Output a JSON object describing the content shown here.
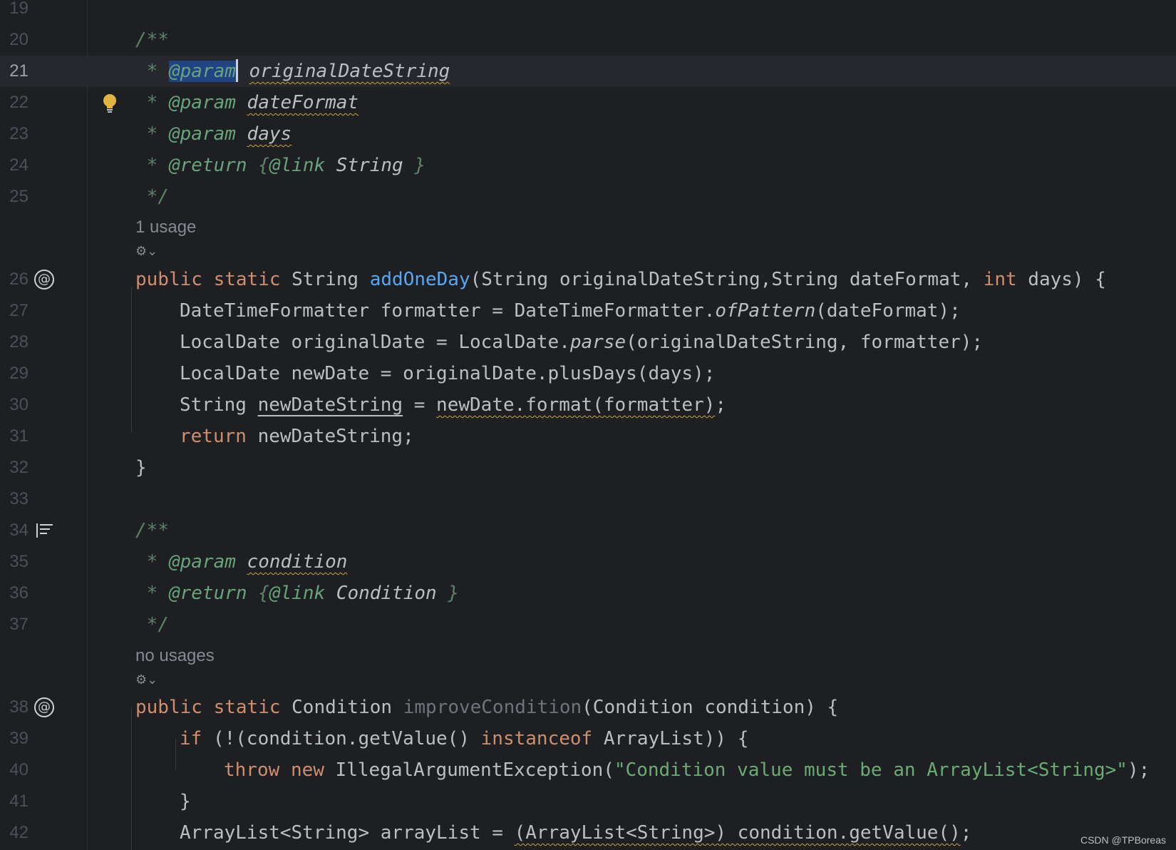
{
  "gutter": {
    "line_numbers": [
      "19",
      "20",
      "21",
      "22",
      "23",
      "24",
      "25",
      "26",
      "27",
      "28",
      "29",
      "30",
      "31",
      "32",
      "33",
      "34",
      "35",
      "36",
      "37",
      "38",
      "39",
      "40",
      "41",
      "42"
    ]
  },
  "code": {
    "l20": "/**",
    "l21": {
      "star": " * ",
      "tag": "@param",
      "name": "originalDateString"
    },
    "l22": {
      "star": " * ",
      "tag": "@param",
      "name": "dateFormat"
    },
    "l23": {
      "star": " * ",
      "tag": "@param",
      "name": "days"
    },
    "l24": {
      "star": " * ",
      "tag": "@return",
      "open": " {",
      "link": "@link",
      "type": " String",
      "close": " }"
    },
    "l25": " */",
    "l26": {
      "kw1": "public",
      "kw2": "static",
      "type": "String",
      "fn": "addOneDay",
      "p1": "(String originalDateString,String dateFormat, ",
      "kw3": "int",
      "p2": " days) {"
    },
    "l27": {
      "a": "DateTimeFormatter formatter = DateTimeFormatter.",
      "i": "ofPattern",
      "b": "(dateFormat);"
    },
    "l28": {
      "a": "LocalDate originalDate = LocalDate.",
      "i": "parse",
      "b": "(originalDateString, formatter);"
    },
    "l29": "LocalDate newDate = originalDate.plusDays(days);",
    "l30": {
      "a": "String ",
      "v": "newDateString",
      "b": " = ",
      "w": "newDate.format(formatter)",
      "c": ";"
    },
    "l31": {
      "kw": "return",
      "rest": " newDateString;"
    },
    "l32": "}",
    "l34": "/**",
    "l35": {
      "star": " * ",
      "tag": "@param",
      "name": "condition"
    },
    "l36": {
      "star": " * ",
      "tag": "@return",
      "open": " {",
      "link": "@link",
      "type": " Condition",
      "close": " }"
    },
    "l37": " */",
    "l38": {
      "kw1": "public",
      "kw2": "static",
      "type": "Condition",
      "fn": "improveCondition",
      "p1": "(Condition condition) {"
    },
    "l39": {
      "kw": "if",
      "a": " (!(condition.getValue() ",
      "kw2": "instanceof",
      "b": " ArrayList)) {"
    },
    "l40": {
      "kw1": "throw",
      "kw2": "new",
      "a": " IllegalArgumentException(",
      "str": "\"Condition value must be an ArrayList<String>\"",
      "b": ");"
    },
    "l41": "}",
    "l42": {
      "a": "ArrayList<String> arrayList = ",
      "w": "(ArrayList<String>) condition.getValue()",
      "b": ";"
    }
  },
  "hints": {
    "usage1": "1 usage",
    "usage2": "no usages"
  },
  "icons": {
    "bulb": "lightbulb-icon",
    "implements": "at-sign-icon",
    "doc": "reader-mode-icon",
    "ai": "ai-assistant-icon"
  },
  "colors": {
    "background": "#1e1f22",
    "keyword": "#cf8e6d",
    "function": "#56a8f5",
    "string": "#6aab73",
    "doc_comment": "#5f826b",
    "selection": "#214283",
    "warning": "#c9a43a"
  },
  "watermark": "CSDN @TPBoreas"
}
